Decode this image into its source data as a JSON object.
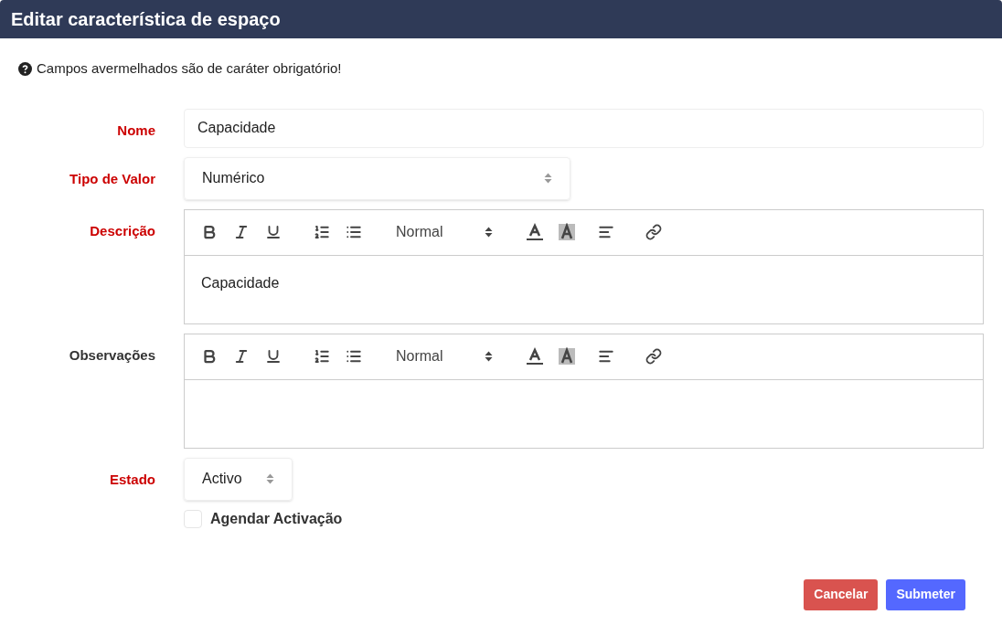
{
  "window": {
    "title": "Editar característica de espaço"
  },
  "notice": "Campos avermelhados são de caráter obrigatório!",
  "fields": [
    {
      "kind": "text",
      "label": "Nome",
      "required": true,
      "value": "Capacidade"
    },
    {
      "kind": "select",
      "label": "Tipo de Valor",
      "required": true,
      "value": "Numérico"
    },
    {
      "kind": "editor",
      "label": "Descrição",
      "required": true,
      "format": "Normal",
      "value": "Capacidade"
    },
    {
      "kind": "editor",
      "label": "Observações",
      "required": false,
      "format": "Normal"
    },
    {
      "kind": "short_select",
      "label": "Estado",
      "required": true,
      "value": "Activo"
    }
  ],
  "schedule": {
    "label": "Agendar Activação",
    "checked": false
  },
  "buttons": [
    {
      "label": "Cancelar",
      "kind": "danger"
    },
    {
      "label": "Submeter",
      "kind": "primary"
    }
  ]
}
